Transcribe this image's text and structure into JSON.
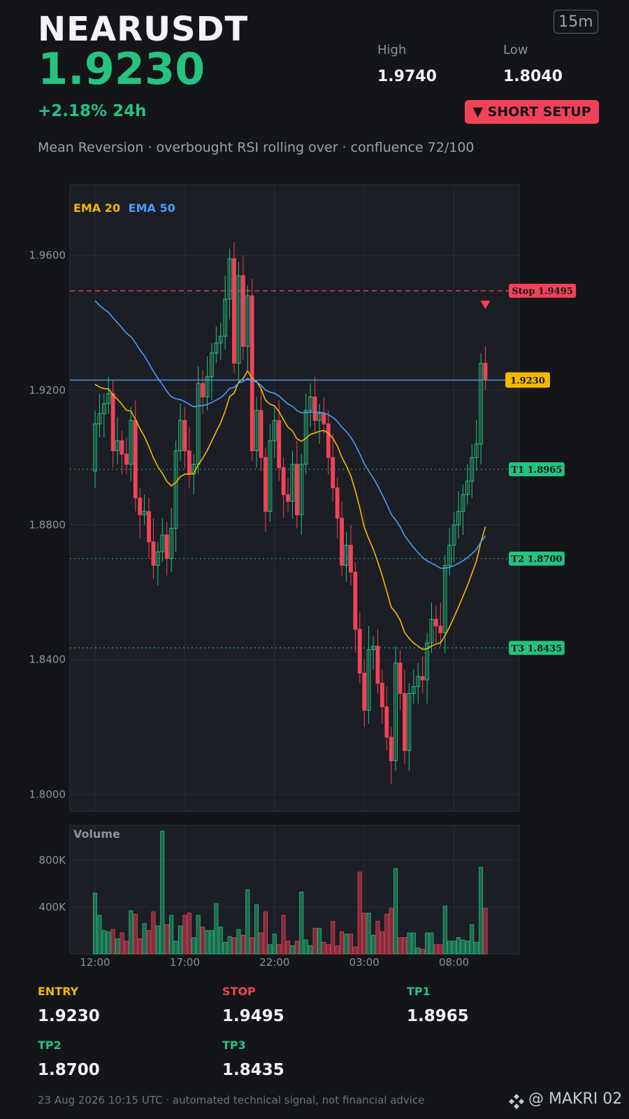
{
  "header": {
    "symbol": "NEARUSDT",
    "price": "1.9230",
    "timeframe": "15m",
    "high_label": "High",
    "high_value": "1.9740",
    "low_label": "Low",
    "low_value": "1.8040",
    "change": "+2.18%  24h",
    "badge": "▼ SHORT SETUP",
    "subtitle": "Mean Reversion · overbought RSI rolling over · confluence 72/100"
  },
  "chart_data": {
    "type": "candlestick",
    "ylim": [
      1.795,
      1.981
    ],
    "yticks": [
      "1.9600",
      "1.9200",
      "1.8800",
      "1.8400",
      "1.8000"
    ],
    "ytick_values": [
      1.96,
      1.92,
      1.88,
      1.84,
      1.8
    ],
    "xticks": [
      "12:00",
      "17:00",
      "22:00",
      "03:00",
      "08:00"
    ],
    "xtick_index": [
      0,
      20,
      40,
      60,
      80
    ],
    "legend": [
      {
        "label": "EMA 20",
        "color": "#f5b800"
      },
      {
        "label": "EMA 50",
        "color": "#4d9bff"
      }
    ],
    "colors": {
      "up": "#26c281",
      "down": "#f2425a",
      "ema20": "#f5b800",
      "ema50": "#4d9bff"
    },
    "price_tag": "1.9230",
    "levels": [
      {
        "label": "Stop 1.9495",
        "value": 1.9495,
        "color": "#f2425a",
        "style": "dashed"
      },
      {
        "label": "T1 1.8965",
        "value": 1.8965,
        "color": "#26c281",
        "style": "dotted"
      },
      {
        "label": "T2 1.8700",
        "value": 1.87,
        "color": "#26c281",
        "style": "dotted"
      },
      {
        "label": "T3 1.8435",
        "value": 1.8435,
        "color": "#26c281",
        "style": "dotted"
      }
    ],
    "closes": [
      1.91,
      1.913,
      1.916,
      1.919,
      1.902,
      1.905,
      1.901,
      1.898,
      1.911,
      1.888,
      1.883,
      1.884,
      1.875,
      1.868,
      1.872,
      1.877,
      1.87,
      1.879,
      1.902,
      1.911,
      1.902,
      1.895,
      1.898,
      1.922,
      1.918,
      1.924,
      1.931,
      1.934,
      1.936,
      1.947,
      1.959,
      1.928,
      1.954,
      1.933,
      1.948,
      1.902,
      1.914,
      1.9,
      1.884,
      1.905,
      1.911,
      1.897,
      1.889,
      1.887,
      1.898,
      1.883,
      1.898,
      1.914,
      1.918,
      1.911,
      1.913,
      1.91,
      1.9,
      1.891,
      1.882,
      1.868,
      1.874,
      1.866,
      1.849,
      1.836,
      1.825,
      1.843,
      1.844,
      1.833,
      1.826,
      1.817,
      1.81,
      1.839,
      1.83,
      1.813,
      1.83,
      1.832,
      1.835,
      1.834,
      1.845,
      1.852,
      1.85,
      1.848,
      1.868,
      1.874,
      1.88,
      1.884,
      1.889,
      1.893,
      1.9,
      1.904,
      1.928,
      1.923
    ],
    "volume": {
      "title": "Volume",
      "yticks": [
        "800K",
        "400K"
      ],
      "ytick_values": [
        800000,
        400000
      ],
      "ymax": 1100000,
      "values": [
        520000,
        330000,
        200000,
        190000,
        210000,
        130000,
        180000,
        110000,
        370000,
        340000,
        130000,
        260000,
        200000,
        360000,
        240000,
        1050000,
        250000,
        330000,
        110000,
        240000,
        330000,
        350000,
        140000,
        330000,
        230000,
        200000,
        200000,
        430000,
        230000,
        100000,
        150000,
        140000,
        210000,
        160000,
        550000,
        140000,
        420000,
        180000,
        360000,
        80000,
        170000,
        80000,
        330000,
        110000,
        70000,
        110000,
        530000,
        120000,
        70000,
        220000,
        220000,
        100000,
        80000,
        280000,
        70000,
        190000,
        170000,
        170000,
        60000,
        700000,
        350000,
        350000,
        160000,
        280000,
        190000,
        340000,
        390000,
        730000,
        140000,
        140000,
        180000,
        180000,
        50000,
        40000,
        180000,
        180000,
        80000,
        80000,
        410000,
        110000,
        110000,
        140000,
        120000,
        110000,
        250000,
        100000,
        740000,
        390000
      ]
    }
  },
  "levels_footer": [
    {
      "label": "ENTRY",
      "value": "1.9230",
      "color": "#f5b800"
    },
    {
      "label": "STOP",
      "value": "1.9495",
      "color": "#f2425a"
    },
    {
      "label": "TP1",
      "value": "1.8965",
      "color": "#26c281"
    },
    {
      "label": "TP2",
      "value": "1.8700",
      "color": "#26c281"
    },
    {
      "label": "TP3",
      "value": "1.8435",
      "color": "#26c281"
    }
  ],
  "footer": {
    "note": "23 Aug 2026 10:15 UTC  ·  automated technical signal, not financial advice",
    "watermark": "@ MAKRI 02"
  }
}
